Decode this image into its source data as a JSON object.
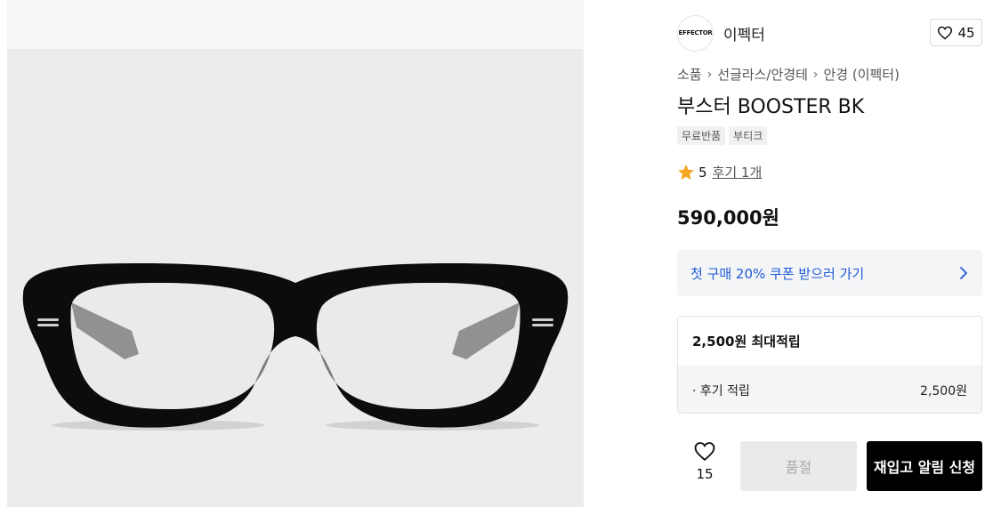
{
  "brand": {
    "name": "이펙터",
    "logo_text": "EFFECTOR",
    "logo_icon": "brand-logo"
  },
  "like": {
    "count": "45",
    "icon": "heart-outline-icon"
  },
  "breadcrumb": [
    "소품",
    "선글라스/안경테",
    "안경 (이펙터)"
  ],
  "product": {
    "title": "부스터 BOOSTER BK",
    "tags": [
      "무료반품",
      "부티크"
    ],
    "rating": "5",
    "reviews_label": "후기 1개",
    "price": "590,000원",
    "image_icon": "eyeglasses-image"
  },
  "coupon": {
    "label": "첫 구매 20% 쿠폰 받으러 가기",
    "icon": "chevron-right-icon",
    "color": "#1f5ad6"
  },
  "points": {
    "title": "2,500원 최대적립",
    "rows": [
      {
        "label": "· 후기 적립",
        "value": "2,500원"
      }
    ]
  },
  "actions": {
    "wish_count": "15",
    "soldout_label": "품절",
    "restock_label": "재입고 알림 신청"
  },
  "colors": {
    "accent": "#1f5ad6",
    "star": "#f5a623",
    "primary_button": "#000000"
  }
}
